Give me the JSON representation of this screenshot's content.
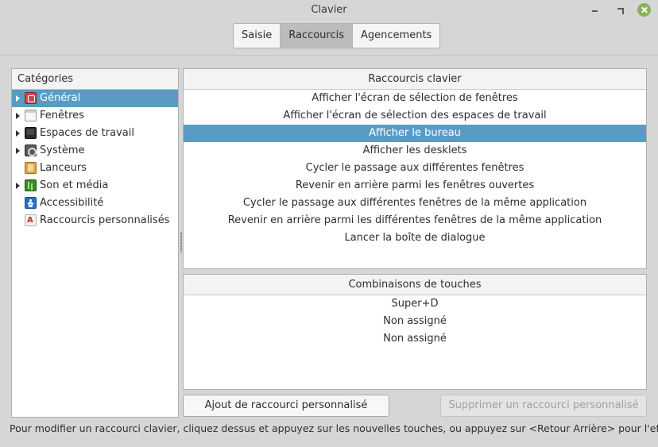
{
  "window": {
    "title": "Clavier"
  },
  "tabs": [
    {
      "label": "Saisie",
      "active": false
    },
    {
      "label": "Raccourcis",
      "active": true
    },
    {
      "label": "Agencements",
      "active": false
    }
  ],
  "categories": {
    "header": "Catégories",
    "items": [
      {
        "label": "Général",
        "icon": "general-icon",
        "expandable": true,
        "selected": true
      },
      {
        "label": "Fenêtres",
        "icon": "windows-icon",
        "expandable": true,
        "selected": false
      },
      {
        "label": "Espaces de travail",
        "icon": "workspaces-icon",
        "expandable": true,
        "selected": false
      },
      {
        "label": "Système",
        "icon": "system-icon",
        "expandable": true,
        "selected": false
      },
      {
        "label": "Lanceurs",
        "icon": "launchers-icon",
        "expandable": false,
        "selected": false
      },
      {
        "label": "Son et média",
        "icon": "sound-media-icon",
        "expandable": true,
        "selected": false
      },
      {
        "label": "Accessibilité",
        "icon": "accessibility-icon",
        "expandable": false,
        "selected": false
      },
      {
        "label": "Raccourcis personnalisés",
        "icon": "custom-shortcuts-icon",
        "expandable": false,
        "selected": false
      }
    ]
  },
  "shortcuts": {
    "header": "Raccourcis clavier",
    "items": [
      "Afficher l'écran de sélection de fenêtres",
      "Afficher l'écran de sélection des espaces de travail",
      "Afficher le bureau",
      "Afficher les desklets",
      "Cycler le passage aux différentes fenêtres",
      "Revenir en arrière parmi les fenêtres ouvertes",
      "Cycler le passage aux différentes fenêtres de la même application",
      "Revenir en arrière parmi les différentes fenêtres de la même application",
      "Lancer la boîte de dialogue"
    ],
    "selected_index": 2
  },
  "bindings": {
    "header": "Combinaisons de touches",
    "items": [
      "Super+D",
      "Non assigné",
      "Non assigné"
    ]
  },
  "buttons": {
    "add": "Ajout de raccourci personnalisé",
    "remove": "Supprimer un raccourci personnalisé"
  },
  "hint": "Pour modifier un raccourci clavier, cliquez dessus et appuyez sur les nouvelles touches, ou appuyez sur <Retour Arrière> pour l'effacer.",
  "colors": {
    "selection": "#5a9bc3",
    "close_button": "#8ab359"
  }
}
